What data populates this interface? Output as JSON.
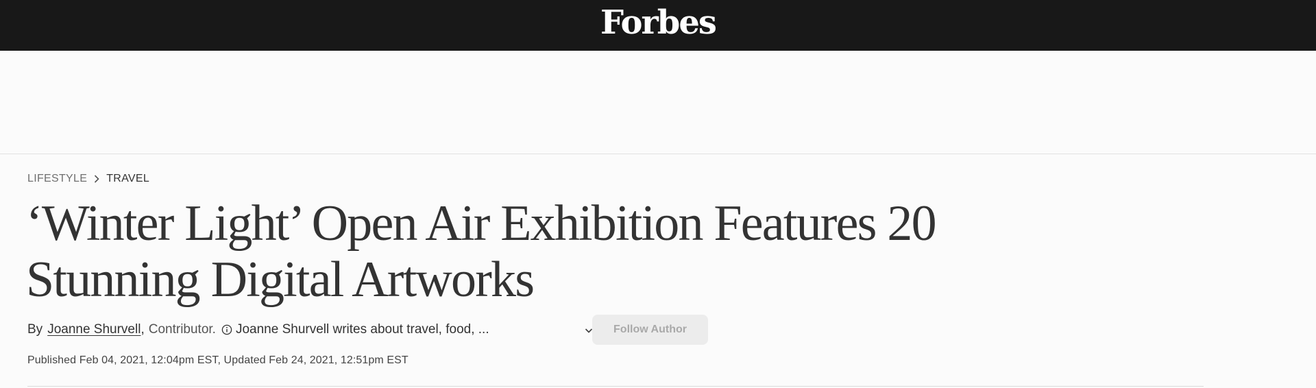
{
  "header": {
    "logo_text": "Forbes",
    "background": "#181818"
  },
  "breadcrumb": {
    "items": [
      "LIFESTYLE",
      "TRAVEL"
    ],
    "separator_icon": "chevron-right-icon"
  },
  "article": {
    "headline": "‘Winter Light’ Open Air Exhibition Features 20 Stunning Digital Artworks",
    "byline": {
      "prefix": "By",
      "author": "Joanne Shurvell",
      "comma": ",",
      "role": "Contributor.",
      "info_icon": "info-icon",
      "bio_snippet": "Joanne Shurvell writes about travel, food, ...",
      "expand_icon": "chevron-down-icon"
    },
    "follow_button": "Follow Author",
    "dates": "Published Feb 04, 2021, 12:04pm EST, Updated Feb 24, 2021, 12:51pm EST"
  },
  "colors": {
    "text": "#333333",
    "muted": "#6f6f6f",
    "button_bg": "#ececec",
    "button_text": "#a9a9a9",
    "page_bg": "#fbfbfb"
  }
}
